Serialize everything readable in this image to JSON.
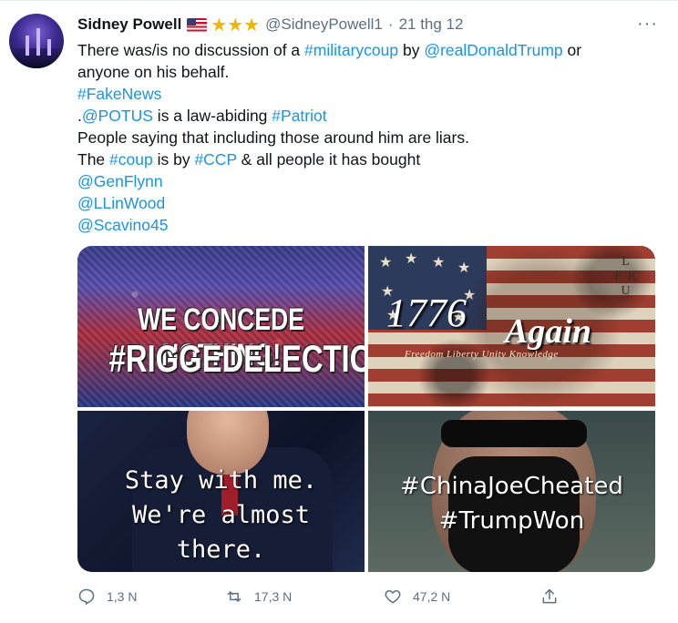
{
  "tweet": {
    "author_name": "Sidney Powell",
    "badge_icons": [
      "us-flag-icon",
      "star-icon",
      "star-icon",
      "star-icon"
    ],
    "stars_text": "★★★",
    "handle": "@SidneyPowell1",
    "separator": "·",
    "date": "21 thg 12",
    "more_text": "···",
    "body": {
      "l1_a": "There was/is no discussion of a ",
      "l1_tag": "#militarycoup",
      "l1_b": " by ",
      "l1_mention": "@realDonaldTrump",
      "l1_c": " or",
      "l2": "anyone on his behalf.",
      "l3_tag": "#FakeNews",
      "l4_a": ".",
      "l4_mention": "@POTUS",
      "l4_b": " is a law-abiding ",
      "l4_tag": "#Patriot",
      "l5": "People saying that including those around him are liars.",
      "l6_a": "The ",
      "l6_tag1": "#coup",
      "l6_b": " is by ",
      "l6_tag2": "#CCP",
      "l6_c": " & all people it has bought",
      "m1": "@GenFlynn",
      "m2": "@LLinWood",
      "m3": "@Scavino45"
    },
    "media": {
      "img1": {
        "line1": "WE CONCEDE NOTHING!",
        "line2": "#RIGGEDELECTION"
      },
      "img2": {
        "year": "1776",
        "again": "Again",
        "motto": "Freedom  Liberty  Unity  Knowledge",
        "letters": "L\nF K\nU"
      },
      "img3": {
        "line1": "Stay with me.",
        "line2": "We're almost",
        "line3": "there."
      },
      "img4": {
        "line1": "#ChinaJoeCheated",
        "line2": "#TrumpWon"
      }
    },
    "actions": {
      "reply_count": "1,3 N",
      "retweet_count": "17,3 N",
      "like_count": "47,2 N"
    }
  },
  "colors": {
    "link": "#1b95e0",
    "muted": "#5b7083",
    "star": "#f4b400"
  }
}
